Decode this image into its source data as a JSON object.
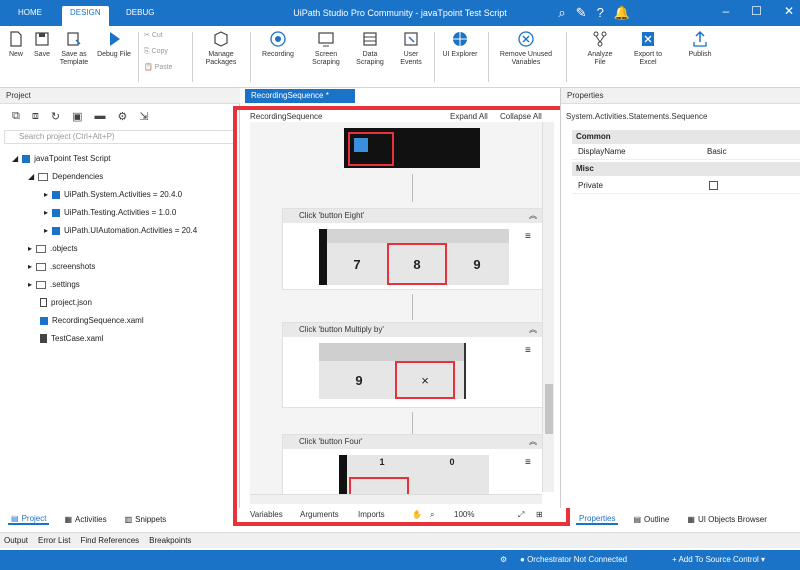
{
  "titlebar": {
    "tabs": [
      "HOME",
      "DESIGN",
      "DEBUG"
    ],
    "title": "UiPath Studio Pro Community - javaTpoint Test Script"
  },
  "ribbon": {
    "buttons": [
      {
        "label": "New",
        "icon": "new-file-icon"
      },
      {
        "label": "Save",
        "icon": "save-icon"
      },
      {
        "label": "Save as Template",
        "icon": "save-template-icon"
      },
      {
        "label": "Debug File",
        "icon": "play-icon"
      },
      {
        "label": "Cut",
        "icon": "cut-icon"
      },
      {
        "label": "Copy",
        "icon": "copy-icon"
      },
      {
        "label": "Paste",
        "icon": "paste-icon"
      },
      {
        "label": "Manage Packages",
        "icon": "package-icon"
      },
      {
        "label": "Recording",
        "icon": "record-icon"
      },
      {
        "label": "Screen Scraping",
        "icon": "screen-icon"
      },
      {
        "label": "Data Scraping",
        "icon": "data-icon"
      },
      {
        "label": "User Events",
        "icon": "events-icon"
      },
      {
        "label": "UI Explorer",
        "icon": "globe-icon"
      },
      {
        "label": "Remove Unused Variables",
        "icon": "remove-icon"
      },
      {
        "label": "Analyze File",
        "icon": "analyze-icon"
      },
      {
        "label": "Export to Excel",
        "icon": "excel-icon"
      },
      {
        "label": "Publish",
        "icon": "publish-icon"
      }
    ]
  },
  "project": {
    "title": "Project",
    "search_placeholder": "Search project (Ctrl+Alt+P)",
    "root": "javaTpoint Test Script",
    "deps_label": "Dependencies",
    "deps": [
      "UiPath.System.Activities = 20.4.0",
      "UiPath.Testing.Activities = 1.0.0",
      "UiPath.UIAutomation.Activities = 20.4"
    ],
    "folders": [
      ".objects",
      ".screenshots",
      ".settings"
    ],
    "files": [
      "project.json",
      "RecordingSequence.xaml",
      "TestCase.xaml"
    ]
  },
  "designer": {
    "tab": "RecordingSequence *",
    "seq_title": "RecordingSequence",
    "expand": "Expand All",
    "collapse": "Collapse All",
    "activities": [
      {
        "title": "Click 'button Eight'",
        "cells": [
          "7",
          "8",
          "9"
        ]
      },
      {
        "title": "Click 'button Multiply by'",
        "cells": [
          "9",
          "×"
        ]
      },
      {
        "title": "Click 'button Four'",
        "cells": [
          "1",
          "0"
        ]
      }
    ],
    "bottom": {
      "variables": "Variables",
      "arguments": "Arguments",
      "imports": "Imports",
      "zoom": "100%"
    }
  },
  "properties": {
    "title": "Properties",
    "subtitle": "System.Activities.Statements.Sequence",
    "cat_common": "Common",
    "display_key": "DisplayName",
    "display_val": "Basic",
    "cat_misc": "Misc",
    "private_key": "Private"
  },
  "left_tabs": [
    "Project",
    "Activities",
    "Snippets"
  ],
  "right_tabs": [
    "Properties",
    "Outline",
    "UI Objects Browser"
  ],
  "output_tabs": [
    "Output",
    "Error List",
    "Find References",
    "Breakpoints"
  ],
  "status": {
    "orchestrator": "Orchestrator Not Connected",
    "source": "Add To Source Control"
  }
}
